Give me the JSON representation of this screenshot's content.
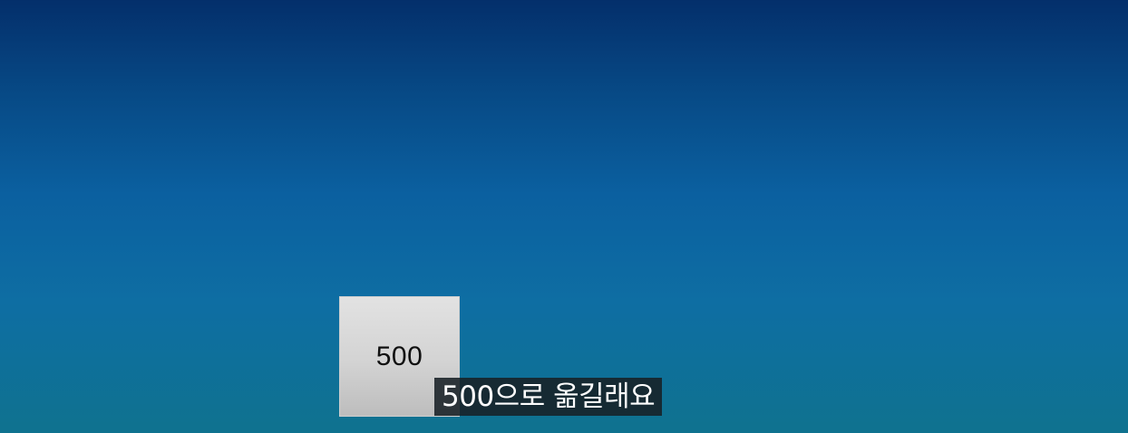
{
  "tile": {
    "label": "500"
  },
  "caption": {
    "text": "500으로 옮길래요"
  },
  "colors": {
    "background_top": "#042f6b",
    "background_bottom": "#0f728f",
    "tile": "#d6d6d6",
    "caption_bg": "#182026",
    "caption_text": "#ffffff"
  }
}
